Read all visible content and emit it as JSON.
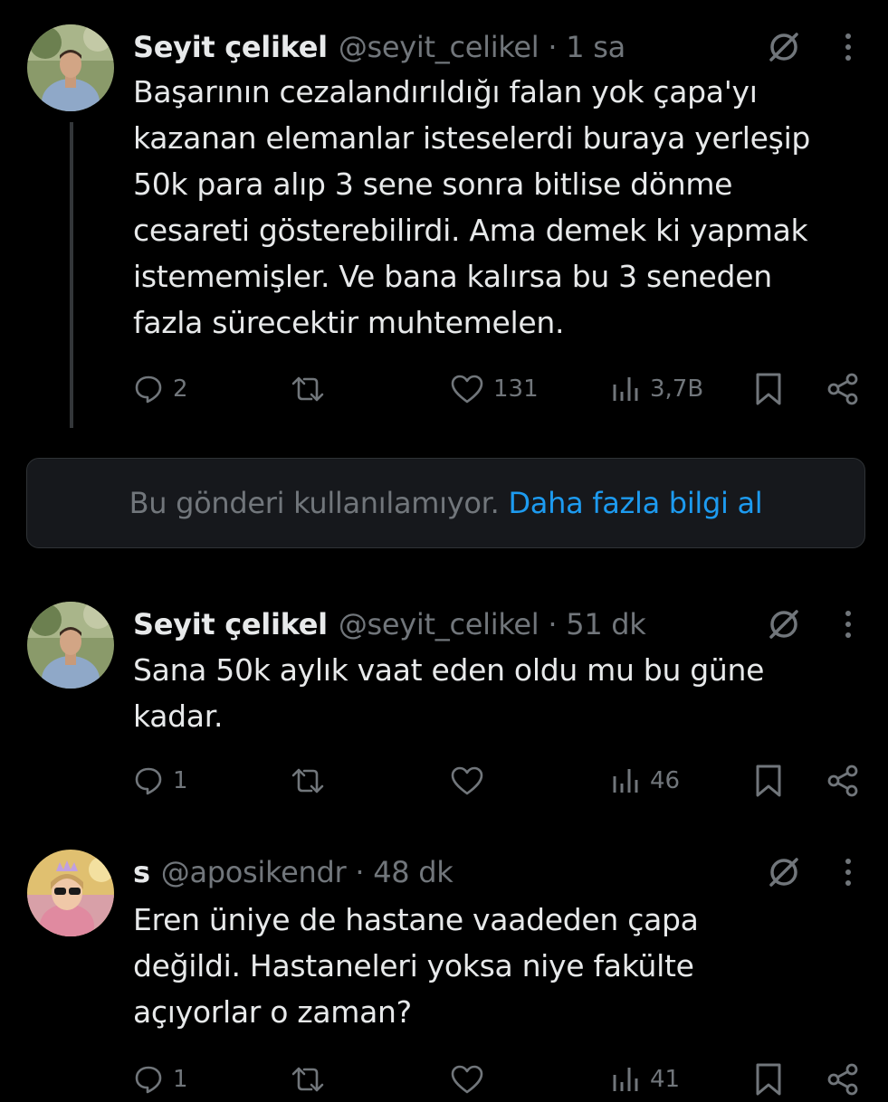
{
  "tweets": [
    {
      "name": "Seyit çelikel",
      "handle": "@seyit_celikel",
      "separator": "·",
      "time": "1 sa",
      "text_lines": [
        "Başarının cezalandırıldığı falan yok çapa'yı",
        "kazanan elemanlar isteselerdi buraya yerleşip",
        "50k para alıp 3 sene sonra bitlise dönme",
        "cesareti gösterebilirdi. Ama demek ki yapmak",
        "istememişler. Ve bana kalırsa bu 3 seneden",
        "fazla sürecektir muhtemelen."
      ],
      "replies": "2",
      "retweets": "",
      "likes": "131",
      "views": "3,7B"
    },
    {
      "name": "Seyit çelikel",
      "handle": "@seyit_celikel",
      "separator": "·",
      "time": "51 dk",
      "text_lines": [
        "Sana 50k aylık vaat eden oldu mu bu güne",
        "kadar."
      ],
      "replies": "1",
      "retweets": "",
      "likes": "",
      "views": "46"
    },
    {
      "name": "s",
      "handle": "@aposikendr",
      "separator": "·",
      "time": "48 dk",
      "text_lines": [
        "Eren üniye de hastane vaadeden çapa",
        "değildi. Hastaneleri yoksa niye fakülte",
        "açıyorlar o zaman?"
      ],
      "replies": "1",
      "retweets": "",
      "likes": "",
      "views": "41"
    }
  ],
  "unavailable_notice": {
    "text": "Bu gönderi kullanılamıyor.",
    "link": "Daha fazla bilgi al"
  },
  "icons": {
    "reply": "reply-icon",
    "retweet": "retweet-icon",
    "like": "like-icon",
    "views": "views-icon",
    "bookmark": "bookmark-icon",
    "share": "share-icon",
    "grok": "grok-icon",
    "more": "more-icon"
  },
  "colors": {
    "background": "#000000",
    "text": "#e7e9ea",
    "muted": "#71767b",
    "link": "#1d9bf0",
    "card": "#16181c",
    "thread_line": "#333639"
  }
}
